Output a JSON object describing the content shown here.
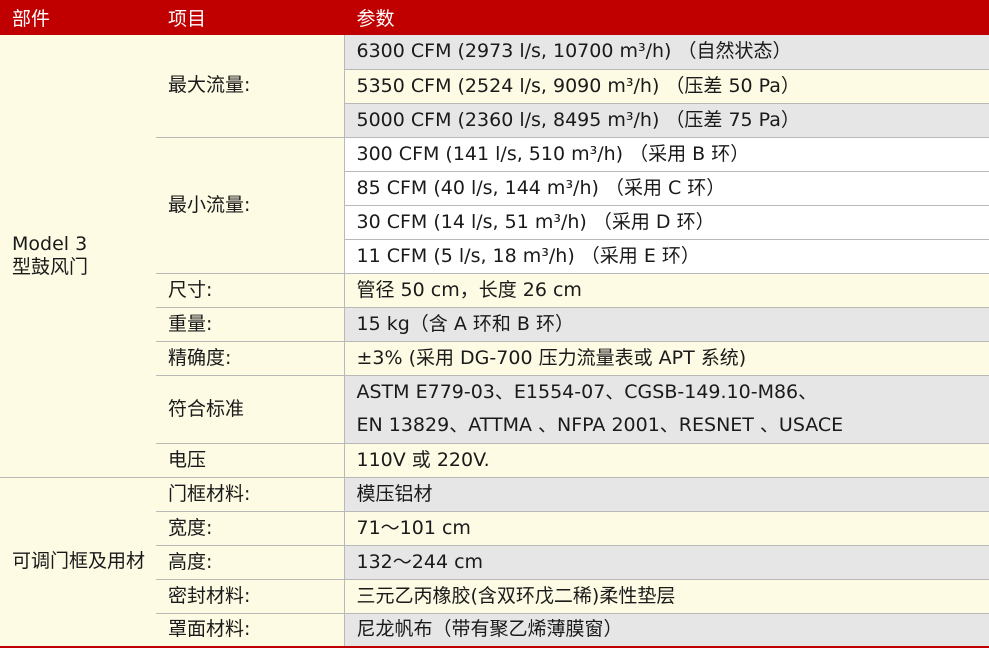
{
  "header": {
    "part": "部件",
    "item": "项目",
    "param": "参数"
  },
  "parts": {
    "model3": "Model 3\n型鼓风门",
    "frame": "可调门框及用材"
  },
  "items": {
    "max_flow": "最大流量:",
    "min_flow": "最小流量:",
    "size": "尺寸:",
    "weight": "重量:",
    "accuracy": "精确度:",
    "standards": "符合标准",
    "voltage": "电压",
    "frame_material": "门框材料:",
    "width": "宽度:",
    "height": "高度:",
    "seal": "密封材料:",
    "cover": "罩面材料:"
  },
  "values": {
    "max_flow_1": "6300 CFM (2973 l/s, 10700 m³/h) （自然状态）",
    "max_flow_2": "5350 CFM (2524 l/s, 9090 m³/h) （压差 50 Pa）",
    "max_flow_3": "5000 CFM (2360 l/s, 8495 m³/h) （压差 75 Pa）",
    "min_flow_1": "300 CFM (141 l/s, 510 m³/h) （采用 B 环）",
    "min_flow_2": "85 CFM (40 l/s, 144 m³/h) （采用 C 环）",
    "min_flow_3": "30 CFM (14 l/s, 51 m³/h) （采用 D 环）",
    "min_flow_4": "11 CFM (5 l/s, 18 m³/h) （采用 E 环）",
    "size": "管径 50 cm，长度 26 cm",
    "weight": "15 kg（含 A 环和 B 环）",
    "accuracy": "±3% (采用  DG-700 压力流量表或 APT 系统)",
    "standards_1": "ASTM E779-03、E1554-07、CGSB-149.10-M86、",
    "standards_2": "EN 13829、ATTMA 、NFPA 2001、RESNET 、USACE",
    "voltage": "110V  或  220V.",
    "frame_material": "模压铝材",
    "width": "71～101 cm",
    "height": "132～244 cm",
    "seal": "三元乙丙橡胶(含双环戊二稀)柔性垫层",
    "cover": "尼龙帆布（带有聚乙烯薄膜窗）"
  },
  "colors": {
    "header_bg": "#c00000",
    "row_cream": "#fdfbe4",
    "row_gray": "#e6e6e6",
    "grid": "#b9b9b9"
  }
}
